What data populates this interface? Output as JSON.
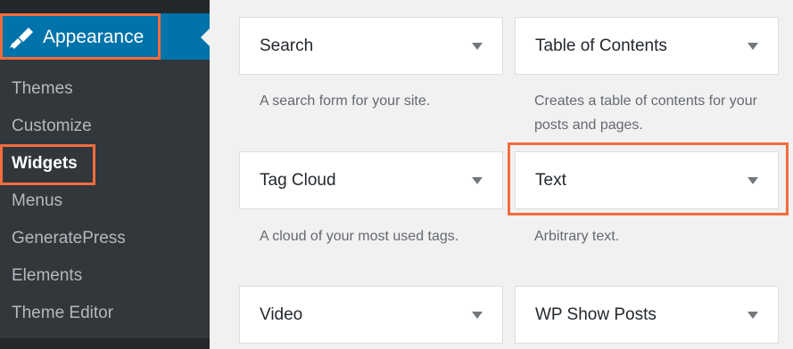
{
  "sidebar": {
    "current": {
      "label": "Appearance",
      "icon": "paintbrush-icon"
    },
    "items": [
      {
        "label": "Themes"
      },
      {
        "label": "Customize"
      },
      {
        "label": "Widgets"
      },
      {
        "label": "Menus"
      },
      {
        "label": "GeneratePress"
      },
      {
        "label": "Elements"
      },
      {
        "label": "Theme Editor"
      }
    ]
  },
  "widgets": [
    {
      "title": "Search",
      "description": "A search form for your site."
    },
    {
      "title": "Table of Contents",
      "description": "Creates a table of contents for your posts and pages."
    },
    {
      "title": "Tag Cloud",
      "description": "A cloud of your most used tags."
    },
    {
      "title": "Text",
      "description": "Arbitrary text."
    },
    {
      "title": "Video",
      "description": ""
    },
    {
      "title": "WP Show Posts",
      "description": ""
    }
  ],
  "colors": {
    "sidebar_bg": "#32373c",
    "active_bg": "#0073aa",
    "highlight_outline": "#f26d3d",
    "content_bg": "#f1f1f1"
  }
}
